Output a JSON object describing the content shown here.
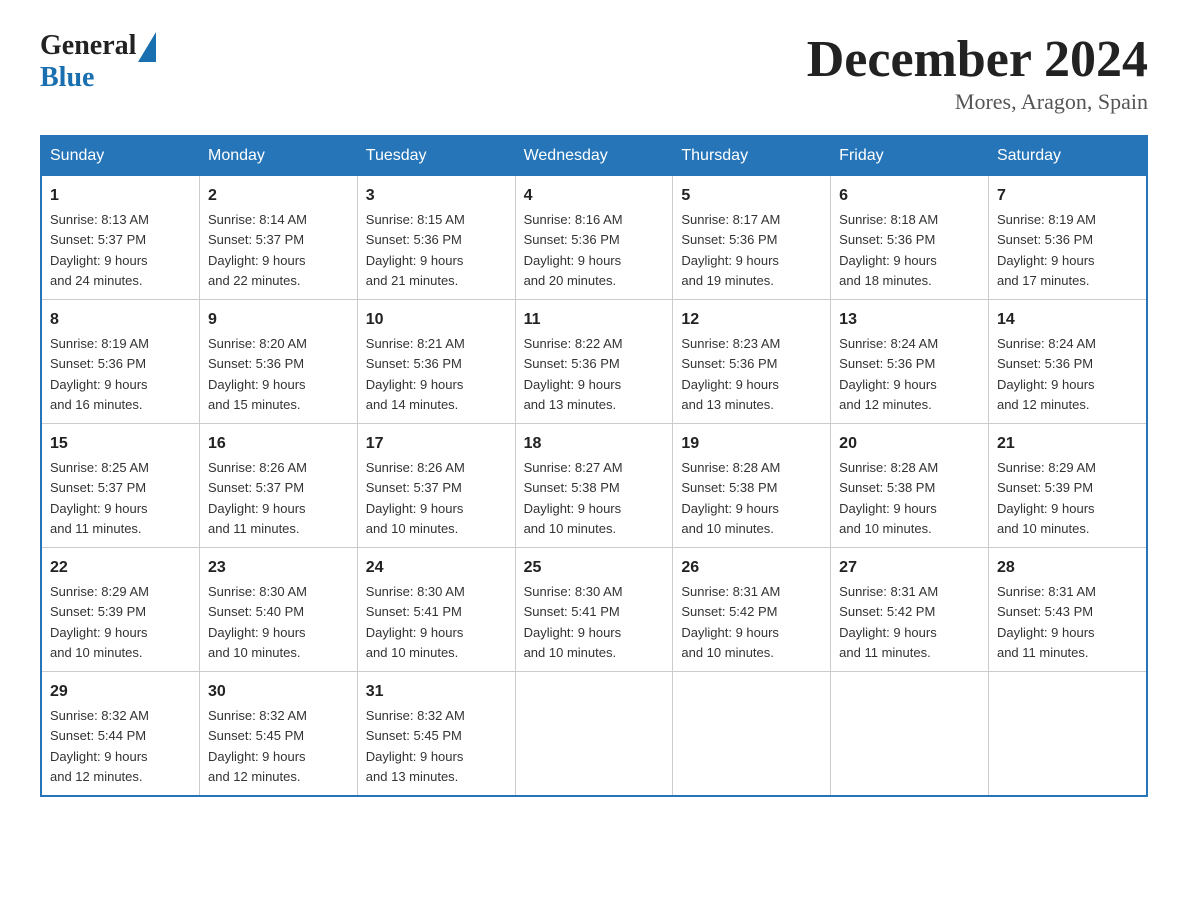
{
  "header": {
    "title": "December 2024",
    "subtitle": "Mores, Aragon, Spain",
    "logo_general": "General",
    "logo_blue": "Blue"
  },
  "days_of_week": [
    "Sunday",
    "Monday",
    "Tuesday",
    "Wednesday",
    "Thursday",
    "Friday",
    "Saturday"
  ],
  "weeks": [
    [
      {
        "day": "1",
        "sunrise": "8:13 AM",
        "sunset": "5:37 PM",
        "daylight": "9 hours and 24 minutes."
      },
      {
        "day": "2",
        "sunrise": "8:14 AM",
        "sunset": "5:37 PM",
        "daylight": "9 hours and 22 minutes."
      },
      {
        "day": "3",
        "sunrise": "8:15 AM",
        "sunset": "5:36 PM",
        "daylight": "9 hours and 21 minutes."
      },
      {
        "day": "4",
        "sunrise": "8:16 AM",
        "sunset": "5:36 PM",
        "daylight": "9 hours and 20 minutes."
      },
      {
        "day": "5",
        "sunrise": "8:17 AM",
        "sunset": "5:36 PM",
        "daylight": "9 hours and 19 minutes."
      },
      {
        "day": "6",
        "sunrise": "8:18 AM",
        "sunset": "5:36 PM",
        "daylight": "9 hours and 18 minutes."
      },
      {
        "day": "7",
        "sunrise": "8:19 AM",
        "sunset": "5:36 PM",
        "daylight": "9 hours and 17 minutes."
      }
    ],
    [
      {
        "day": "8",
        "sunrise": "8:19 AM",
        "sunset": "5:36 PM",
        "daylight": "9 hours and 16 minutes."
      },
      {
        "day": "9",
        "sunrise": "8:20 AM",
        "sunset": "5:36 PM",
        "daylight": "9 hours and 15 minutes."
      },
      {
        "day": "10",
        "sunrise": "8:21 AM",
        "sunset": "5:36 PM",
        "daylight": "9 hours and 14 minutes."
      },
      {
        "day": "11",
        "sunrise": "8:22 AM",
        "sunset": "5:36 PM",
        "daylight": "9 hours and 13 minutes."
      },
      {
        "day": "12",
        "sunrise": "8:23 AM",
        "sunset": "5:36 PM",
        "daylight": "9 hours and 13 minutes."
      },
      {
        "day": "13",
        "sunrise": "8:24 AM",
        "sunset": "5:36 PM",
        "daylight": "9 hours and 12 minutes."
      },
      {
        "day": "14",
        "sunrise": "8:24 AM",
        "sunset": "5:36 PM",
        "daylight": "9 hours and 12 minutes."
      }
    ],
    [
      {
        "day": "15",
        "sunrise": "8:25 AM",
        "sunset": "5:37 PM",
        "daylight": "9 hours and 11 minutes."
      },
      {
        "day": "16",
        "sunrise": "8:26 AM",
        "sunset": "5:37 PM",
        "daylight": "9 hours and 11 minutes."
      },
      {
        "day": "17",
        "sunrise": "8:26 AM",
        "sunset": "5:37 PM",
        "daylight": "9 hours and 10 minutes."
      },
      {
        "day": "18",
        "sunrise": "8:27 AM",
        "sunset": "5:38 PM",
        "daylight": "9 hours and 10 minutes."
      },
      {
        "day": "19",
        "sunrise": "8:28 AM",
        "sunset": "5:38 PM",
        "daylight": "9 hours and 10 minutes."
      },
      {
        "day": "20",
        "sunrise": "8:28 AM",
        "sunset": "5:38 PM",
        "daylight": "9 hours and 10 minutes."
      },
      {
        "day": "21",
        "sunrise": "8:29 AM",
        "sunset": "5:39 PM",
        "daylight": "9 hours and 10 minutes."
      }
    ],
    [
      {
        "day": "22",
        "sunrise": "8:29 AM",
        "sunset": "5:39 PM",
        "daylight": "9 hours and 10 minutes."
      },
      {
        "day": "23",
        "sunrise": "8:30 AM",
        "sunset": "5:40 PM",
        "daylight": "9 hours and 10 minutes."
      },
      {
        "day": "24",
        "sunrise": "8:30 AM",
        "sunset": "5:41 PM",
        "daylight": "9 hours and 10 minutes."
      },
      {
        "day": "25",
        "sunrise": "8:30 AM",
        "sunset": "5:41 PM",
        "daylight": "9 hours and 10 minutes."
      },
      {
        "day": "26",
        "sunrise": "8:31 AM",
        "sunset": "5:42 PM",
        "daylight": "9 hours and 10 minutes."
      },
      {
        "day": "27",
        "sunrise": "8:31 AM",
        "sunset": "5:42 PM",
        "daylight": "9 hours and 11 minutes."
      },
      {
        "day": "28",
        "sunrise": "8:31 AM",
        "sunset": "5:43 PM",
        "daylight": "9 hours and 11 minutes."
      }
    ],
    [
      {
        "day": "29",
        "sunrise": "8:32 AM",
        "sunset": "5:44 PM",
        "daylight": "9 hours and 12 minutes."
      },
      {
        "day": "30",
        "sunrise": "8:32 AM",
        "sunset": "5:45 PM",
        "daylight": "9 hours and 12 minutes."
      },
      {
        "day": "31",
        "sunrise": "8:32 AM",
        "sunset": "5:45 PM",
        "daylight": "9 hours and 13 minutes."
      },
      null,
      null,
      null,
      null
    ]
  ],
  "labels": {
    "sunrise": "Sunrise:",
    "sunset": "Sunset:",
    "daylight": "Daylight:"
  }
}
